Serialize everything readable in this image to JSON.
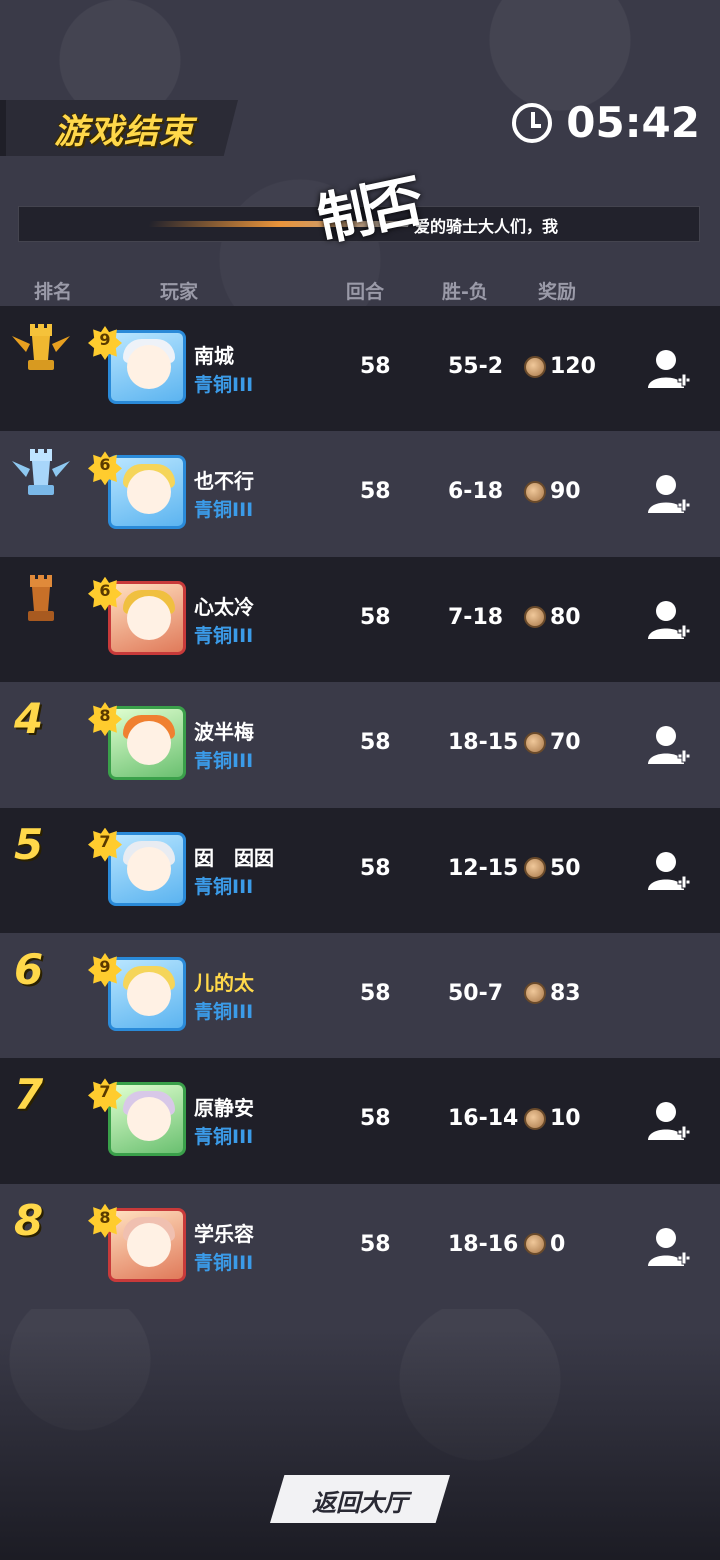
{
  "header": {
    "title": "游戏结束",
    "timer": "05:42",
    "marquee_text": "爱的骑士大人们，我",
    "glitch_text": "制否"
  },
  "columns": {
    "rank": "排名",
    "player": "玩家",
    "rounds": "回合",
    "win_loss": "胜-负",
    "reward": "奖励"
  },
  "rows": [
    {
      "rank": "",
      "trophy": "gold-trophy",
      "level": "9",
      "name": "南城",
      "tier": "青铜III",
      "rounds": "58",
      "wl": "55-2",
      "reward": "120",
      "add_friend": true,
      "self": false
    },
    {
      "rank": "",
      "trophy": "silver-trophy",
      "level": "6",
      "name": "也不行",
      "tier": "青铜III",
      "rounds": "58",
      "wl": "6-18",
      "reward": "90",
      "add_friend": true,
      "self": false
    },
    {
      "rank": "",
      "trophy": "bronze-trophy",
      "level": "6",
      "name": "心太冷",
      "tier": "青铜III",
      "rounds": "58",
      "wl": "7-18",
      "reward": "80",
      "add_friend": true,
      "self": false
    },
    {
      "rank": "4",
      "trophy": "",
      "level": "8",
      "name": "波半梅",
      "tier": "青铜III",
      "rounds": "58",
      "wl": "18-15",
      "reward": "70",
      "add_friend": true,
      "self": false
    },
    {
      "rank": "5",
      "trophy": "",
      "level": "7",
      "name": "囡　囡囡",
      "tier": "青铜III",
      "rounds": "58",
      "wl": "12-15",
      "reward": "50",
      "add_friend": true,
      "self": false
    },
    {
      "rank": "6",
      "trophy": "",
      "level": "9",
      "name": "儿的太",
      "tier": "青铜III",
      "rounds": "58",
      "wl": "50-7",
      "reward": "83",
      "add_friend": false,
      "self": true
    },
    {
      "rank": "7",
      "trophy": "",
      "level": "7",
      "name": "原静安",
      "tier": "青铜III",
      "rounds": "58",
      "wl": "16-14",
      "reward": "10",
      "add_friend": true,
      "self": false
    },
    {
      "rank": "8",
      "trophy": "",
      "level": "8",
      "name": "学乐容",
      "tier": "青铜III",
      "rounds": "58",
      "wl": "18-16",
      "reward": "0",
      "add_friend": true,
      "self": false
    }
  ],
  "footer": {
    "back_button": "返回大厅"
  },
  "colors": {
    "gold": "#ffd84a",
    "tier_blue": "#3b9be8",
    "row_dark": "#1f1f28",
    "row_light": "#3a3a48"
  }
}
